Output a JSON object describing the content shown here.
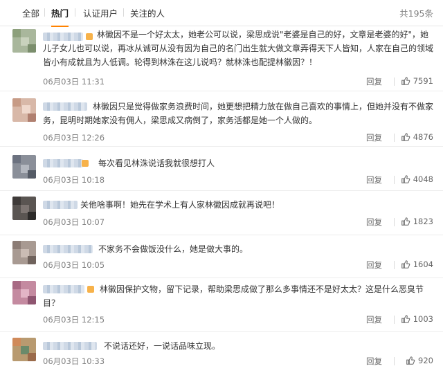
{
  "tabs": [
    {
      "label": "全部",
      "active": false
    },
    {
      "label": "热门",
      "active": true
    },
    {
      "label": "认证用户",
      "active": false
    },
    {
      "label": "关注的人",
      "active": false
    }
  ],
  "total_label": "共195条",
  "accent_color": "#ff8200",
  "comments": [
    {
      "text": "林徽因不是一个好太太，她老公可以说，梁思成说\"老婆是自己的好，文章是老婆的好\"，她儿子女儿也可以说，再冰从诚可从没有因为自己的名门出生就大做文章弄得天下人皆知，人家在自己的领域皆小有成就且为人低调。轮得到林洙在这儿说吗？就林洙也配提林徽因？！",
      "time": "06月03日 11:31",
      "reply": "回复",
      "likes": "7591"
    },
    {
      "text": "林徽因只是觉得做家务浪费时间，她更想把精力放在做自己喜欢的事情上，但她并没有不做家务，昆明时期她家没有佣人，梁思成又病倒了，家务活都是她一个人做的。",
      "time": "06月03日 12:26",
      "reply": "回复",
      "likes": "4876"
    },
    {
      "text": "每次看见林洙说话我就很想打人",
      "time": "06月03日 10:18",
      "reply": "回复",
      "likes": "4048"
    },
    {
      "text": "关他啥事啊！她先在学术上有人家林徽因成就再说吧！",
      "time": "06月03日 10:07",
      "reply": "回复",
      "likes": "1823"
    },
    {
      "text": "不家务不会做饭没什么，她是做大事的。",
      "time": "06月03日 10:05",
      "reply": "回复",
      "likes": "1604"
    },
    {
      "text": "林徽因保护文物，留下记录，帮助梁思成做了那么多事情还不是好太太？这是什么恶臭节目？",
      "time": "06月03日 12:15",
      "reply": "回复",
      "likes": "1003"
    },
    {
      "text": "不说话还好，一说话品味立现。",
      "time": "06月03日 10:33",
      "reply": "回复",
      "likes": "920"
    }
  ]
}
